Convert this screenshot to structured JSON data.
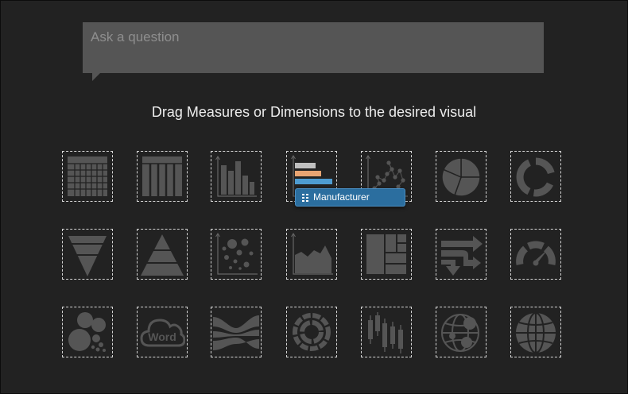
{
  "question_box": {
    "placeholder": "Ask a question",
    "value": ""
  },
  "instructions": "Drag Measures or Dimensions to the desired visual",
  "drag_item": {
    "label": "Manufacturer",
    "icon": "dimension-grip-icon"
  },
  "visuals": [
    {
      "icon": "table-icon"
    },
    {
      "icon": "column-list-icon"
    },
    {
      "icon": "bar-chart-icon"
    },
    {
      "icon": "horizontal-bar-chart-icon"
    },
    {
      "icon": "scatter-plot-icon"
    },
    {
      "icon": "pie-chart-icon"
    },
    {
      "icon": "donut-chart-icon"
    },
    {
      "icon": "funnel-chart-icon"
    },
    {
      "icon": "pyramid-chart-icon"
    },
    {
      "icon": "bubble-chart-icon"
    },
    {
      "icon": "area-chart-icon"
    },
    {
      "icon": "treemap-icon"
    },
    {
      "icon": "sankey-flow-icon"
    },
    {
      "icon": "gauge-icon"
    },
    {
      "icon": "packed-bubbles-icon"
    },
    {
      "icon": "word-cloud-icon",
      "label": "Word"
    },
    {
      "icon": "streamgraph-icon"
    },
    {
      "icon": "sunburst-icon"
    },
    {
      "icon": "candlestick-chart-icon"
    },
    {
      "icon": "bubble-map-icon"
    },
    {
      "icon": "filled-map-icon"
    }
  ],
  "colors": {
    "background": "#222222",
    "icon_gray": "#555555",
    "chip_blue": "#2b6e9f",
    "bar_accent_orange": "#e8a472",
    "bar_accent_blue": "#4e9cd1"
  }
}
